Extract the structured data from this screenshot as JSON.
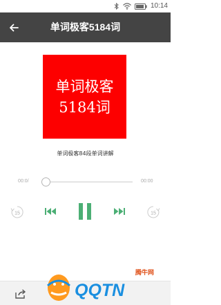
{
  "status_bar": {
    "time": "10:14",
    "icons": [
      "bluetooth-icon",
      "wifi-icon",
      "battery-icon"
    ]
  },
  "header": {
    "title": "单词极客5184词",
    "back_icon": "arrow-left-icon"
  },
  "cover": {
    "line1": "单词极客",
    "line2": "5184词",
    "background_color": "#fd0000"
  },
  "track": {
    "subtitle": "单词极客84段单词讲解"
  },
  "player": {
    "current_time": "00:0/",
    "total_time": "00:00",
    "progress": 0,
    "rewind_seconds": "15",
    "forward_seconds": "15",
    "state": "playing",
    "accent_color": "#4caf75"
  },
  "bottom_bar": {
    "share_icon": "share-icon"
  },
  "watermark": {
    "text": "QQTN",
    "brand": "腾牛网"
  }
}
